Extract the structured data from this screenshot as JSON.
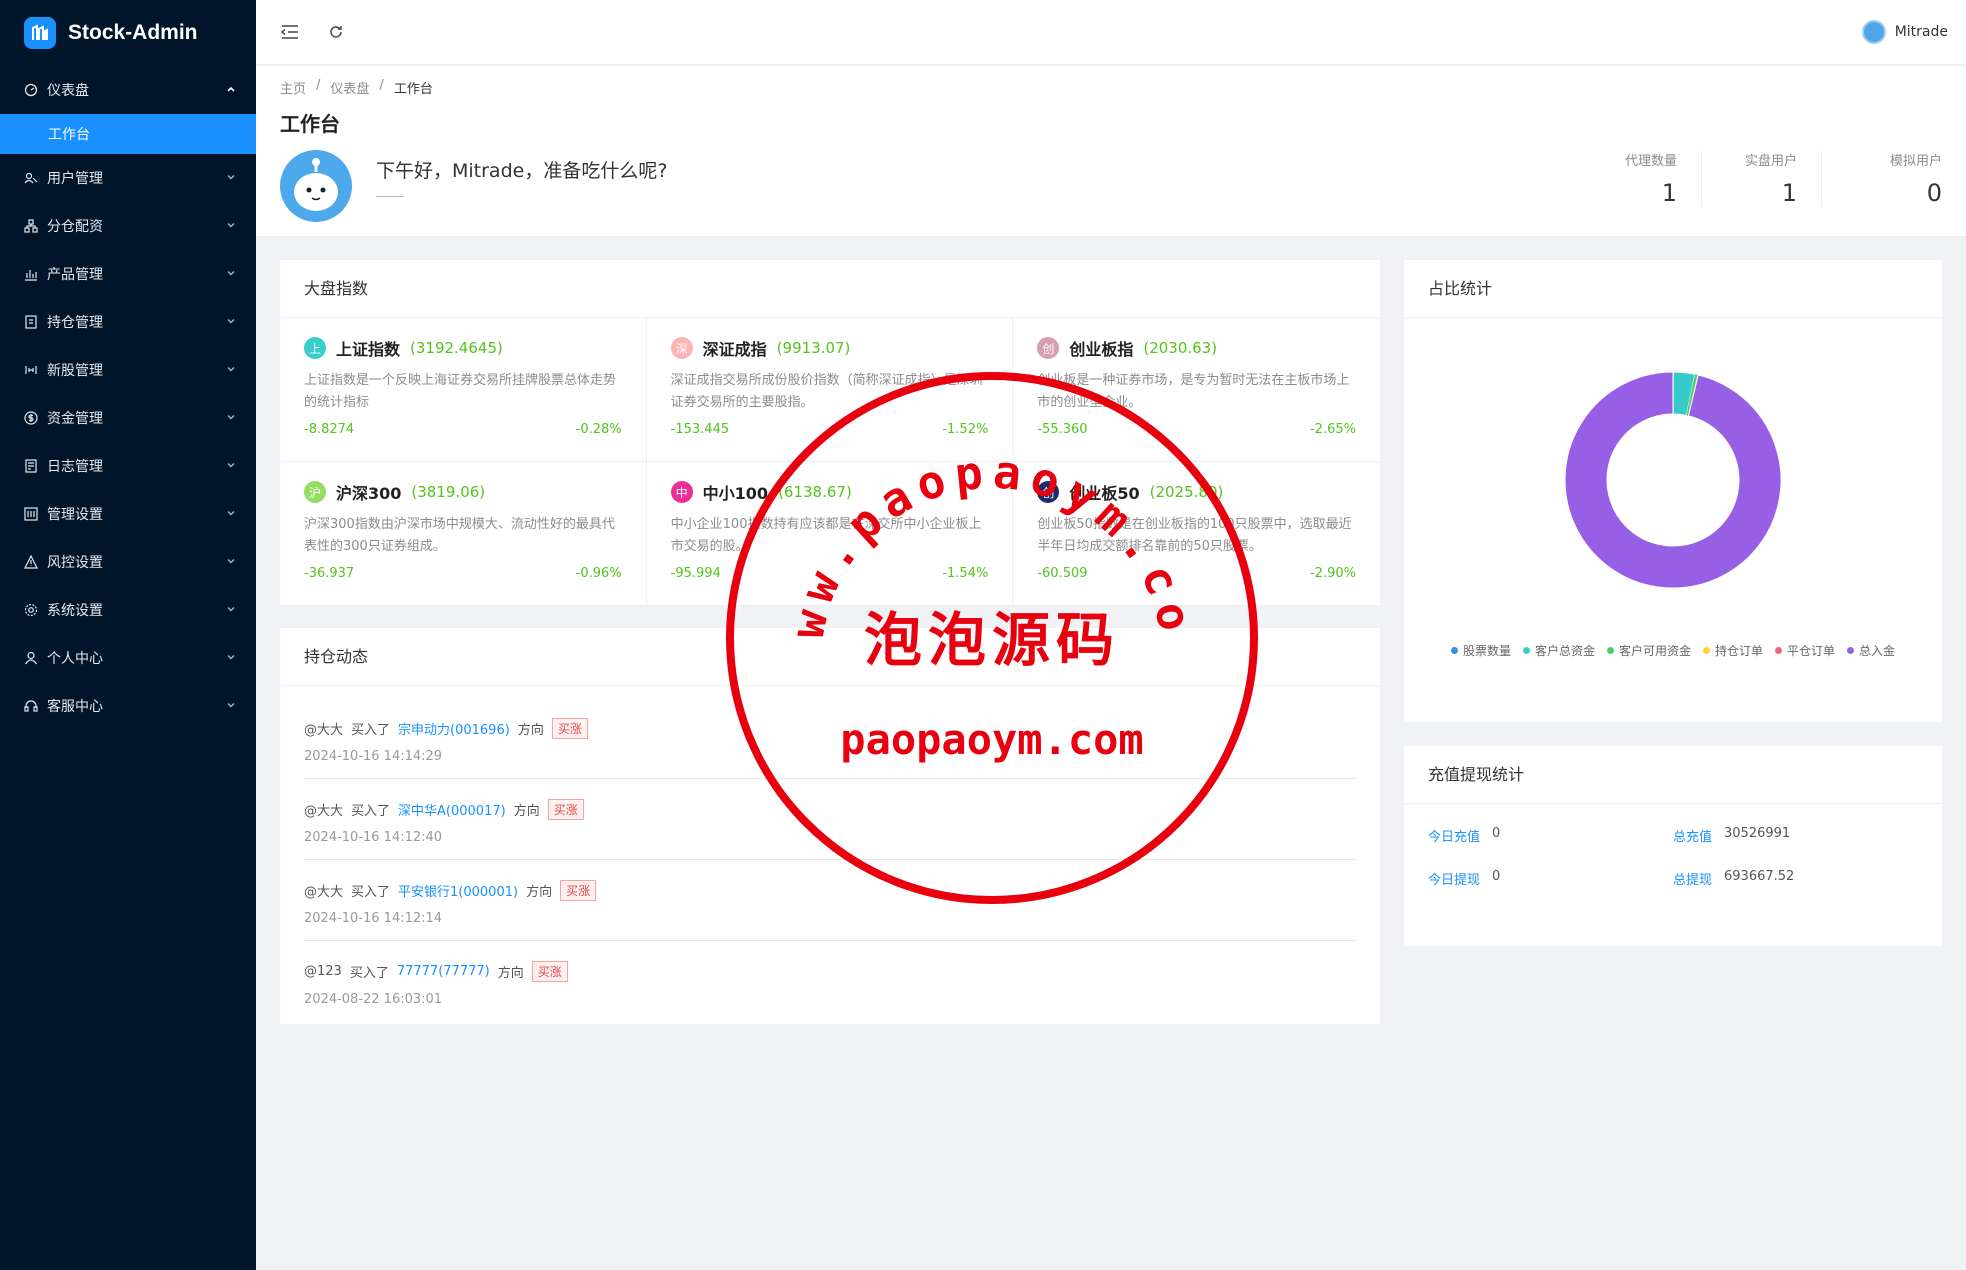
{
  "app": {
    "name": "Stock-Admin"
  },
  "sidebar": {
    "dashboard": {
      "label": "仪表盘",
      "icon": "dashboard-icon",
      "expanded": true
    },
    "dashboard_sub": {
      "label": "工作台"
    },
    "items": [
      {
        "label": "用户管理",
        "icon": "users-icon"
      },
      {
        "label": "分仓配资",
        "icon": "split-warehouse-icon"
      },
      {
        "label": "产品管理",
        "icon": "bar-chart-icon"
      },
      {
        "label": "持仓管理",
        "icon": "position-icon"
      },
      {
        "label": "新股管理",
        "icon": "ipo-icon"
      },
      {
        "label": "资金管理",
        "icon": "dollar-icon"
      },
      {
        "label": "日志管理",
        "icon": "log-icon"
      },
      {
        "label": "管理设置",
        "icon": "admin-settings-icon"
      },
      {
        "label": "风控设置",
        "icon": "warning-icon"
      },
      {
        "label": "系统设置",
        "icon": "gear-icon"
      },
      {
        "label": "个人中心",
        "icon": "person-icon"
      },
      {
        "label": "客服中心",
        "icon": "headset-icon"
      }
    ]
  },
  "header": {
    "user_name": "Mitrade"
  },
  "breadcrumb": {
    "home": "主页",
    "section": "仪表盘",
    "current": "工作台"
  },
  "page": {
    "title": "工作台",
    "greeting": "下午好，Mitrade，准备吃什么呢?",
    "stats": [
      {
        "label": "代理数量",
        "value": "1"
      },
      {
        "label": "实盘用户",
        "value": "1"
      },
      {
        "label": "模拟用户",
        "value": "0"
      }
    ]
  },
  "market": {
    "title": "大盘指数",
    "indices": [
      {
        "badge": "上",
        "color": "#36cfc9",
        "name": "上证指数",
        "price": "(3192.4645)",
        "desc": "上证指数是一个反映上海证券交易所挂牌股票总体走势的统计指标",
        "change": "-8.8274",
        "pct": "-0.28%"
      },
      {
        "badge": "深",
        "color": "#ffb3b3",
        "name": "深证成指",
        "price": "(9913.07)",
        "desc": "深证成指交易所成份股价指数（简称深证成指）是深圳证券交易所的主要股指。",
        "change": "-153.445",
        "pct": "-1.52%"
      },
      {
        "badge": "创",
        "color": "#d69fb4",
        "name": "创业板指",
        "price": "(2030.63)",
        "desc": "创业板是一种证券市场，是专为暂时无法在主板市场上市的创业型企业。",
        "change": "-55.360",
        "pct": "-2.65%"
      },
      {
        "badge": "沪",
        "color": "#95de64",
        "name": "沪深300",
        "price": "(3819.06)",
        "desc": "沪深300指数由沪深市场中规模大、流动性好的最具代表性的300只证券组成。",
        "change": "-36.937",
        "pct": "-0.96%"
      },
      {
        "badge": "中",
        "color": "#eb2f96",
        "name": "中小100",
        "price": "(6138.67)",
        "desc": "中小企业100指数持有应该都是在深交所中小企业板上市交易的股。",
        "change": "-95.994",
        "pct": "-1.54%"
      },
      {
        "badge": "创",
        "color": "#1d2a6b",
        "name": "创业板50",
        "price": "(2025.80)",
        "desc": "创业板50指数是在创业板指的100只股票中，选取最近半年日均成交额排名靠前的50只股票。",
        "change": "-60.509",
        "pct": "-2.90%"
      }
    ]
  },
  "positions": {
    "title": "持仓动态",
    "buy_text": "买入了",
    "direction_label": "方向",
    "items": [
      {
        "user": "@大大",
        "stock": "宗申动力(001696)",
        "tag": "买涨",
        "time": "2024-10-16 14:14:29"
      },
      {
        "user": "@大大",
        "stock": "深中华A(000017)",
        "tag": "买涨",
        "time": "2024-10-16 14:12:40"
      },
      {
        "user": "@大大",
        "stock": "平安银行1(000001)",
        "tag": "买涨",
        "time": "2024-10-16 14:12:14"
      },
      {
        "user": "@123",
        "stock": "77777(77777)",
        "tag": "买涨",
        "time": "2024-08-22 16:03:01"
      }
    ]
  },
  "ratio": {
    "title": "占比统计"
  },
  "chart_data": {
    "type": "pie",
    "donut": true,
    "legend_position": "bottom",
    "categories": [
      "股票数量",
      "客户总资金",
      "客户可用资金",
      "持仓订单",
      "平仓订单",
      "总入金"
    ],
    "colors": [
      "#3a8ee6",
      "#36cbcb",
      "#4ecb73",
      "#fad337",
      "#f2637b",
      "#975fe5"
    ],
    "values": [
      0.05,
      3.2,
      0.4,
      0.05,
      0.05,
      96.25
    ]
  },
  "recharge": {
    "title": "充值提现统计",
    "items": [
      {
        "label": "今日充值",
        "value": "0"
      },
      {
        "label": "总充值",
        "value": "30526991"
      },
      {
        "label": "今日提现",
        "value": "0"
      },
      {
        "label": "总提现",
        "value": "693667.52"
      }
    ]
  },
  "watermark": {
    "url_arc": "www.paopaoym.com",
    "brand": "泡泡源码",
    "domain": "paopaoym.com"
  }
}
